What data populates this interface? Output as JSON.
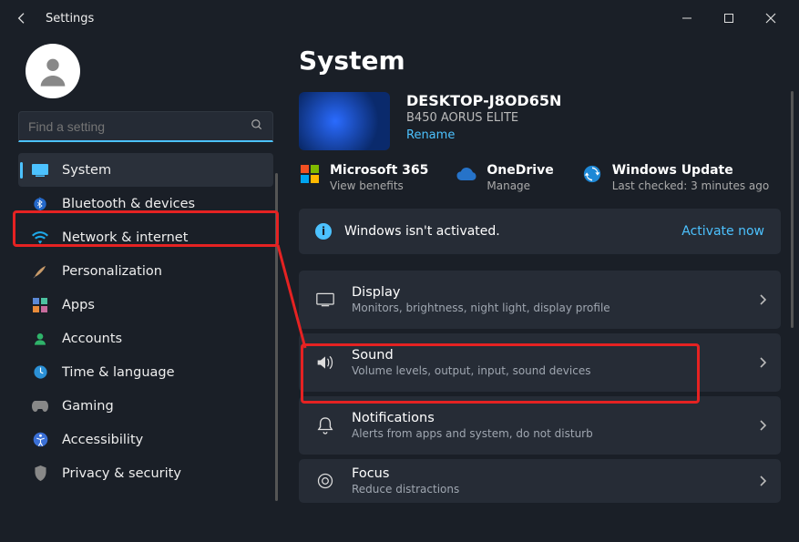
{
  "window": {
    "title": "Settings"
  },
  "search": {
    "placeholder": "Find a setting"
  },
  "sidebar": {
    "items": [
      {
        "label": "System"
      },
      {
        "label": "Bluetooth & devices"
      },
      {
        "label": "Network & internet"
      },
      {
        "label": "Personalization"
      },
      {
        "label": "Apps"
      },
      {
        "label": "Accounts"
      },
      {
        "label": "Time & language"
      },
      {
        "label": "Gaming"
      },
      {
        "label": "Accessibility"
      },
      {
        "label": "Privacy & security"
      }
    ]
  },
  "page": {
    "heading": "System",
    "device": {
      "name": "DESKTOP-J8OD65N",
      "board": "B450 AORUS ELITE",
      "rename": "Rename"
    },
    "services": [
      {
        "name": "Microsoft 365",
        "action": "View benefits"
      },
      {
        "name": "OneDrive",
        "action": "Manage"
      },
      {
        "name": "Windows Update",
        "action": "Last checked: 3 minutes ago"
      }
    ],
    "activation": {
      "message": "Windows isn't activated.",
      "cta": "Activate now"
    },
    "settings": [
      {
        "title": "Display",
        "sub": "Monitors, brightness, night light, display profile"
      },
      {
        "title": "Sound",
        "sub": "Volume levels, output, input, sound devices"
      },
      {
        "title": "Notifications",
        "sub": "Alerts from apps and system, do not disturb"
      },
      {
        "title": "Focus",
        "sub": "Reduce distractions"
      }
    ]
  }
}
